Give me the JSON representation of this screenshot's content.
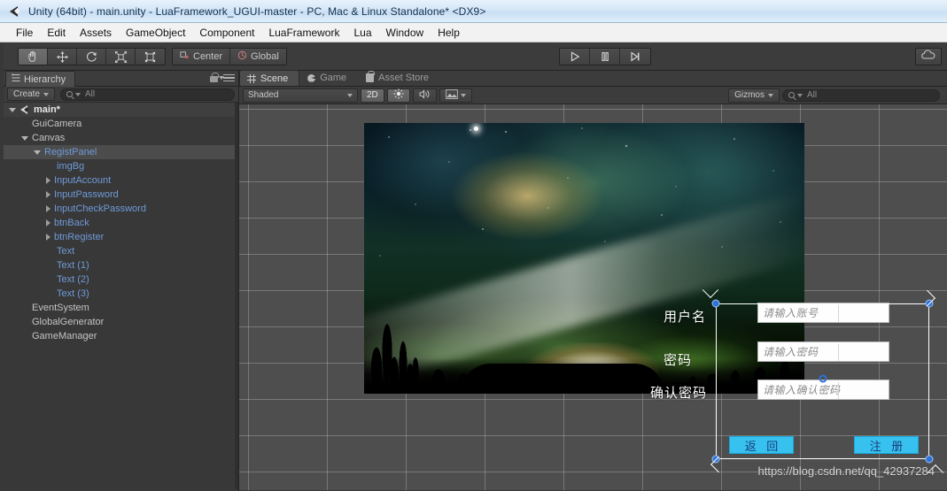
{
  "window": {
    "title": "Unity (64bit) - main.unity - LuaFramework_UGUI-master - PC, Mac & Linux Standalone* <DX9>",
    "icon": "unity-icon"
  },
  "menu": {
    "items": [
      {
        "label": "File"
      },
      {
        "label": "Edit"
      },
      {
        "label": "Assets"
      },
      {
        "label": "GameObject"
      },
      {
        "label": "Component"
      },
      {
        "label": "LuaFramework"
      },
      {
        "label": "Lua"
      },
      {
        "label": "Window"
      },
      {
        "label": "Help"
      }
    ]
  },
  "toolbar": {
    "transform_tools": [
      {
        "name": "hand-tool",
        "icon": "hand-icon",
        "active": true
      },
      {
        "name": "move-tool",
        "icon": "move-icon",
        "active": false
      },
      {
        "name": "rotate-tool",
        "icon": "rotate-icon",
        "active": false
      },
      {
        "name": "scale-tool",
        "icon": "scale-icon",
        "active": false
      },
      {
        "name": "rect-tool",
        "icon": "rect-transform-icon",
        "active": false
      }
    ],
    "pivot_label": "Center",
    "pivot_icon": "pivot-center-icon",
    "handle_label": "Global",
    "handle_icon": "globe-icon",
    "play_label": "Play",
    "pause_label": "Pause",
    "step_label": "Step",
    "cloud_label": "Unity Services",
    "cloud_icon": "cloud-icon"
  },
  "hierarchy": {
    "tab_label": "Hierarchy",
    "tab_icon": "hierarchy-icon",
    "lock_icon": "lock-icon",
    "menu_icon": "panel-menu-icon",
    "create_label": "Create",
    "search_placeholder": "All",
    "search_value": "",
    "search_icon": "search-icon",
    "rows": [
      {
        "label": "main*",
        "depth": 0,
        "kind": "scene",
        "fold": "open",
        "selected": false
      },
      {
        "label": "GuiCamera",
        "depth": 1,
        "kind": "object",
        "fold": "none",
        "selected": false
      },
      {
        "label": "Canvas",
        "depth": 1,
        "kind": "object",
        "fold": "open",
        "selected": false
      },
      {
        "label": "RegistPanel",
        "depth": 2,
        "kind": "prefab",
        "fold": "open",
        "selected": true
      },
      {
        "label": "imgBg",
        "depth": 3,
        "kind": "prefab",
        "fold": "none",
        "selected": false
      },
      {
        "label": "InputAccount",
        "depth": 3,
        "kind": "prefab",
        "fold": "closed",
        "selected": false
      },
      {
        "label": "InputPassword",
        "depth": 3,
        "kind": "prefab",
        "fold": "closed",
        "selected": false
      },
      {
        "label": "InputCheckPassword",
        "depth": 3,
        "kind": "prefab",
        "fold": "closed",
        "selected": false
      },
      {
        "label": "btnBack",
        "depth": 3,
        "kind": "prefab",
        "fold": "closed",
        "selected": false
      },
      {
        "label": "btnRegister",
        "depth": 3,
        "kind": "prefab",
        "fold": "closed",
        "selected": false
      },
      {
        "label": "Text",
        "depth": 3,
        "kind": "prefab",
        "fold": "none",
        "selected": false
      },
      {
        "label": "Text (1)",
        "depth": 3,
        "kind": "prefab",
        "fold": "none",
        "selected": false
      },
      {
        "label": "Text (2)",
        "depth": 3,
        "kind": "prefab",
        "fold": "none",
        "selected": false
      },
      {
        "label": "Text (3)",
        "depth": 3,
        "kind": "prefab",
        "fold": "none",
        "selected": false
      },
      {
        "label": "EventSystem",
        "depth": 1,
        "kind": "object",
        "fold": "none",
        "selected": false
      },
      {
        "label": "GlobalGenerator",
        "depth": 1,
        "kind": "object",
        "fold": "none",
        "selected": false
      },
      {
        "label": "GameManager",
        "depth": 1,
        "kind": "object",
        "fold": "none",
        "selected": false
      }
    ]
  },
  "scene_panel": {
    "tabs": [
      {
        "label": "Scene",
        "icon": "scene-grid-icon",
        "active": true
      },
      {
        "label": "Game",
        "icon": "game-pacman-icon",
        "active": false
      },
      {
        "label": "Asset Store",
        "icon": "asset-store-icon",
        "active": false
      }
    ],
    "draw_mode": "Shaded",
    "two_d_label": "2D",
    "two_d_active": true,
    "lighting_icon": "sun-icon",
    "audio_icon": "audio-icon",
    "effects_icon": "effects-icon",
    "gizmos_label": "Gizmos",
    "gizmos_search_placeholder": "All",
    "gizmos_search_value": ""
  },
  "game_ui": {
    "fields": [
      {
        "label": "用户名",
        "placeholder": "请输入账号"
      },
      {
        "label": "密码",
        "placeholder": "请输入密码"
      },
      {
        "label": "确认密码",
        "placeholder": "请输入确认密码"
      }
    ],
    "buttons": [
      {
        "name": "back-button",
        "label": "返 回"
      },
      {
        "name": "register-button",
        "label": "注 册"
      }
    ]
  },
  "watermark": "https://blog.csdn.net/qq_42937284",
  "colors": {
    "title_bar": "#d4e6f7",
    "editor_bg": "#383838",
    "panel_bg": "#3c3c3c",
    "scene_bg": "#4e4e4e",
    "prefab_blue": "#6f9ad8",
    "selection_blue": "#2f72d8",
    "button_cyan": "#37c1ef",
    "button_text": "#1a3a78"
  }
}
